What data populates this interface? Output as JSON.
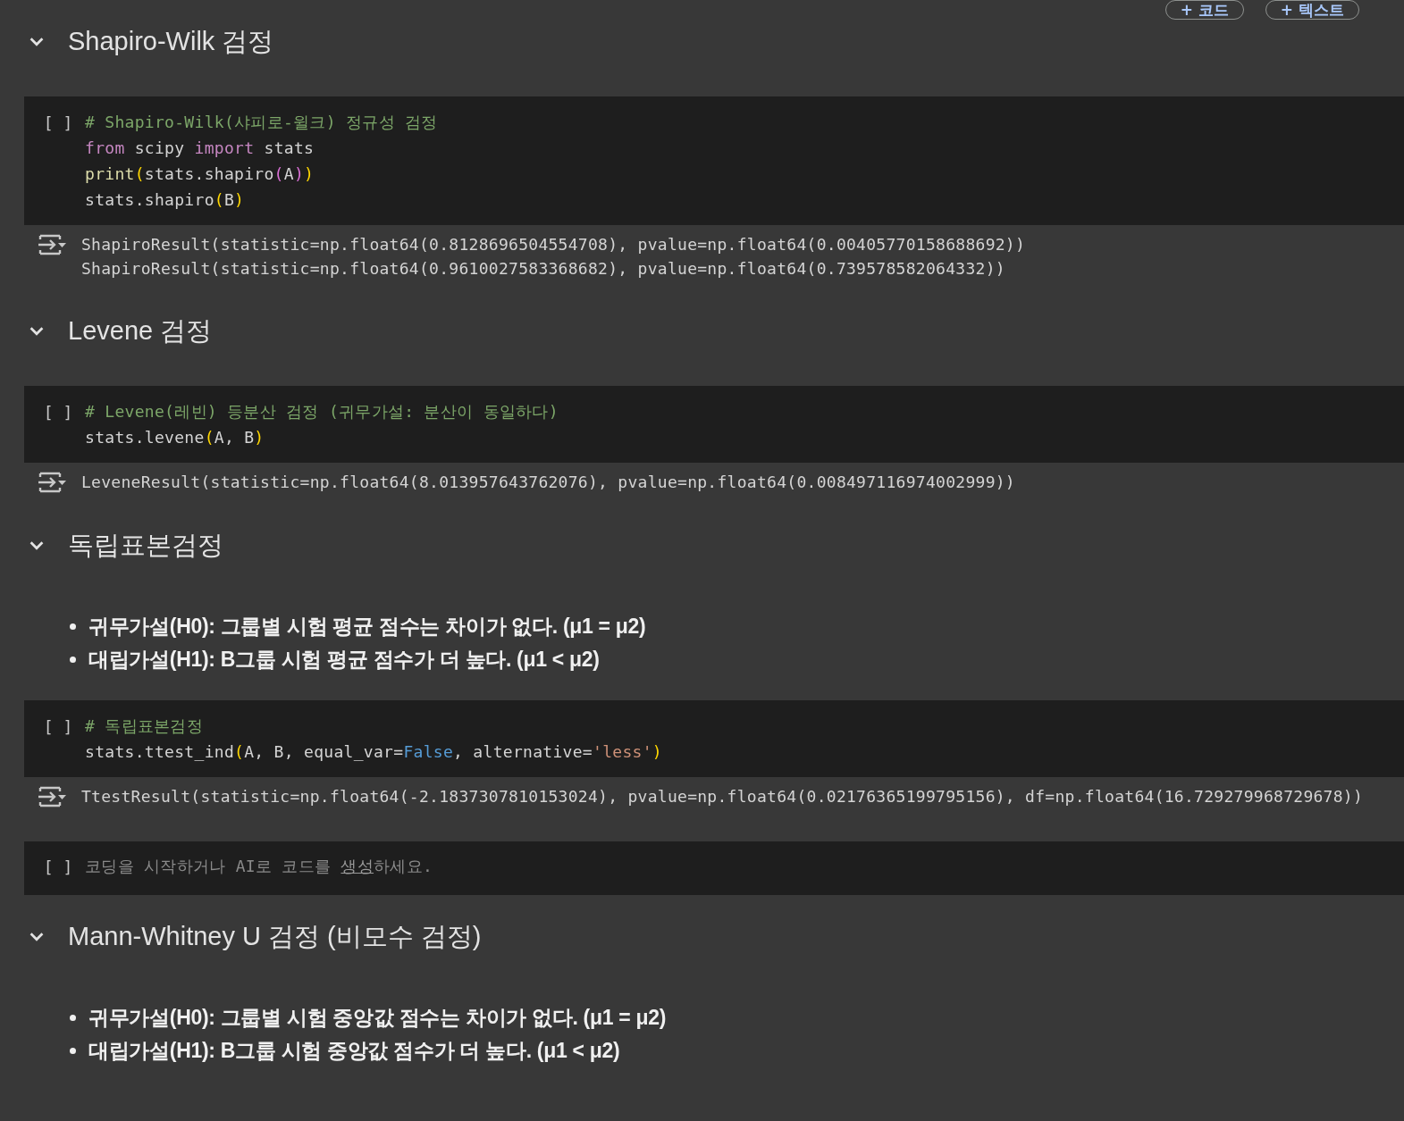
{
  "toolbar": {
    "buttons": [
      "+ 코드",
      "+ 텍스트"
    ]
  },
  "cells": [
    {
      "kind": "heading",
      "text": "Shapiro-Wilk 검정",
      "expanded": true
    },
    {
      "kind": "code",
      "run_label": "[ ]",
      "lines": [
        [
          {
            "t": "# Shapiro-Wilk(샤피로-윌크) 정규성 검정",
            "kind": "comment"
          }
        ],
        [
          {
            "t": "from",
            "kind": "kw"
          },
          {
            "t": " scipy ",
            "kind": "plain"
          },
          {
            "t": "import",
            "kind": "kw"
          },
          {
            "t": " stats",
            "kind": "plain"
          }
        ],
        [
          {
            "t": "print",
            "kind": "fn"
          },
          {
            "t": "(",
            "kind": "p1"
          },
          {
            "t": "stats.shapiro",
            "kind": "plain"
          },
          {
            "t": "(",
            "kind": "p2"
          },
          {
            "t": "A",
            "kind": "plain"
          },
          {
            "t": ")",
            "kind": "p2"
          },
          {
            "t": ")",
            "kind": "p1"
          }
        ],
        [
          {
            "t": "stats.shapiro",
            "kind": "plain"
          },
          {
            "t": "(",
            "kind": "p1"
          },
          {
            "t": "B",
            "kind": "plain"
          },
          {
            "t": ")",
            "kind": "p1"
          }
        ]
      ],
      "output": [
        "ShapiroResult(statistic=np.float64(0.8128696504554708), pvalue=np.float64(0.00405770158688692))",
        "ShapiroResult(statistic=np.float64(0.9610027583368682), pvalue=np.float64(0.739578582064332))"
      ]
    },
    {
      "kind": "heading",
      "text": "Levene 검정",
      "expanded": true
    },
    {
      "kind": "code",
      "run_label": "[ ]",
      "lines": [
        [
          {
            "t": "# Levene(레빈) 등분산 검정 (귀무가설: 분산이 동일하다)",
            "kind": "comment"
          }
        ],
        [
          {
            "t": "stats.levene",
            "kind": "plain"
          },
          {
            "t": "(",
            "kind": "p1"
          },
          {
            "t": "A, B",
            "kind": "plain"
          },
          {
            "t": ")",
            "kind": "p1"
          }
        ]
      ],
      "output": [
        "LeveneResult(statistic=np.float64(8.013957643762076), pvalue=np.float64(0.008497116974002999))"
      ]
    },
    {
      "kind": "heading",
      "text": "독립표본검정",
      "expanded": true
    },
    {
      "kind": "bullets",
      "items": [
        "귀무가설(H0): 그룹별 시험 평균 점수는 차이가 없다. (μ1 = μ2)",
        "대립가설(H1): B그룹 시험 평균 점수가 더 높다. (μ1 < μ2)"
      ]
    },
    {
      "kind": "code",
      "run_label": "[ ]",
      "lines": [
        [
          {
            "t": "# 독립표본검정",
            "kind": "comment"
          }
        ],
        [
          {
            "t": "stats.ttest_ind",
            "kind": "plain"
          },
          {
            "t": "(",
            "kind": "p1"
          },
          {
            "t": "A, B, equal_var=",
            "kind": "plain"
          },
          {
            "t": "False",
            "kind": "bool"
          },
          {
            "t": ", alternative=",
            "kind": "plain"
          },
          {
            "t": "'less'",
            "kind": "str"
          },
          {
            "t": ")",
            "kind": "p1"
          }
        ]
      ],
      "output": [
        "TtestResult(statistic=np.float64(-2.1837307810153024), pvalue=np.float64(0.02176365199795156), df=np.float64(16.729279968729678))"
      ]
    },
    {
      "kind": "empty",
      "run_label": "[ ]",
      "prompt": [
        {
          "t": "코딩을 시작하거나 AI로 코드를 ",
          "link": false
        },
        {
          "t": "생성",
          "link": true
        },
        {
          "t": "하세요.",
          "link": false
        }
      ]
    },
    {
      "kind": "heading",
      "text": "Mann-Whitney U 검정 (비모수 검정)",
      "expanded": true
    },
    {
      "kind": "bullets",
      "items": [
        "귀무가설(H0): 그룹별 시험 중앙값 점수는 차이가 없다. (μ1 = μ2)",
        "대립가설(H1): B그룹 시험 중앙값 점수가 더 높다. (μ1 < μ2)"
      ]
    }
  ]
}
